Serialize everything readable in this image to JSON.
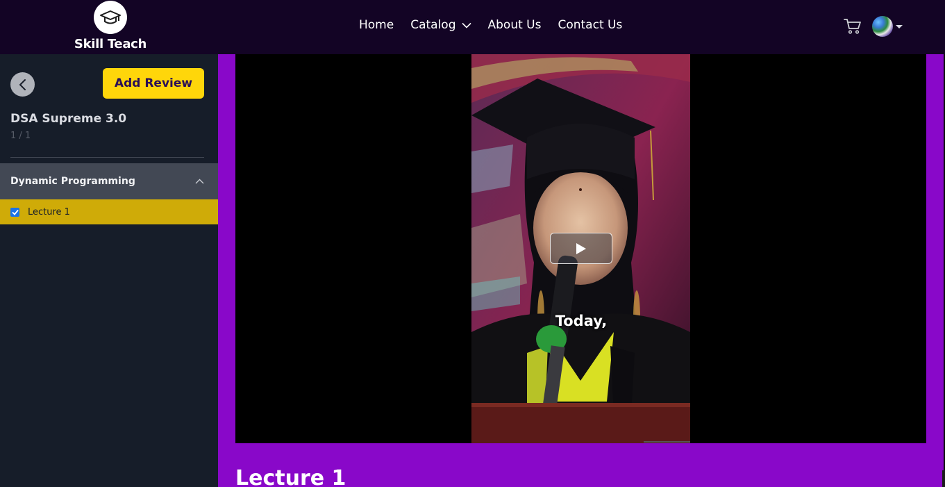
{
  "brand": {
    "name": "Skill Teach"
  },
  "nav": {
    "items": [
      {
        "label": "Home"
      },
      {
        "label": "Catalog"
      },
      {
        "label": "About Us"
      },
      {
        "label": "Contact Us"
      }
    ]
  },
  "header_icons": {
    "cart": "cart-icon",
    "avatar": "user-avatar",
    "dropdown": "caret-down-icon"
  },
  "sidebar": {
    "back_icon": "chevron-left-icon",
    "add_review_label": "Add Review",
    "course_title": "DSA Supreme 3.0",
    "progress": "1 / 1",
    "section": {
      "title": "Dynamic Programming",
      "expanded": true,
      "toggle_icon": "chevron-up-icon"
    },
    "lectures": [
      {
        "label": "Lecture 1",
        "completed": true,
        "active": true
      }
    ]
  },
  "player": {
    "play_icon": "play-icon",
    "caption": "Today,"
  },
  "lecture": {
    "title": "Lecture 1"
  },
  "colors": {
    "topbar": "#130425",
    "sidebar": "#161d29",
    "main_bg": "#8908c9",
    "accent_yellow": "#ffd60a",
    "active_lecture": "#cfab08"
  }
}
